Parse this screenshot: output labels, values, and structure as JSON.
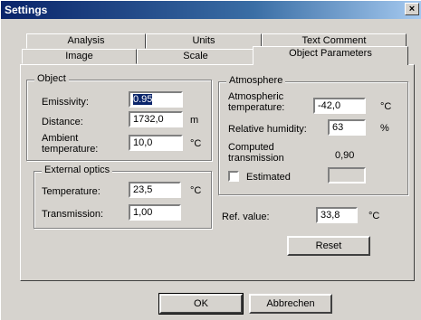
{
  "window": {
    "title": "Settings",
    "close_glyph": "×"
  },
  "tabs": {
    "row_back": [
      "Analysis",
      "Units",
      "Text Comment"
    ],
    "row_front": [
      "Image",
      "Scale",
      "Object Parameters"
    ],
    "active": "Object Parameters"
  },
  "object": {
    "title": "Object",
    "emissivity": {
      "label": "Emissivity:",
      "value": "0.95"
    },
    "distance": {
      "label": "Distance:",
      "value": "1732,0",
      "unit": "m"
    },
    "ambient": {
      "label": "Ambient\ntemperature:",
      "value": "10,0",
      "unit": "°C"
    }
  },
  "external_optics": {
    "title": "External optics",
    "temperature": {
      "label": "Temperature:",
      "value": "23,5",
      "unit": "°C"
    },
    "transmission": {
      "label": "Transmission:",
      "value": "1,00"
    }
  },
  "atmosphere": {
    "title": "Atmosphere",
    "temperature": {
      "label": "Atmospheric\ntemperature:",
      "value": "-42,0",
      "unit": "°C"
    },
    "humidity": {
      "label": "Relative humidity:",
      "value": "63",
      "unit": "%"
    },
    "computed": {
      "label": "Computed\ntransmission",
      "value": "0,90"
    },
    "estimated": {
      "label": "Estimated",
      "checked": false,
      "value": ""
    }
  },
  "reference": {
    "label": "Ref. value:",
    "value": "33,8",
    "unit": "°C"
  },
  "buttons": {
    "reset": "Reset",
    "ok": "OK",
    "cancel": "Abbrechen"
  }
}
